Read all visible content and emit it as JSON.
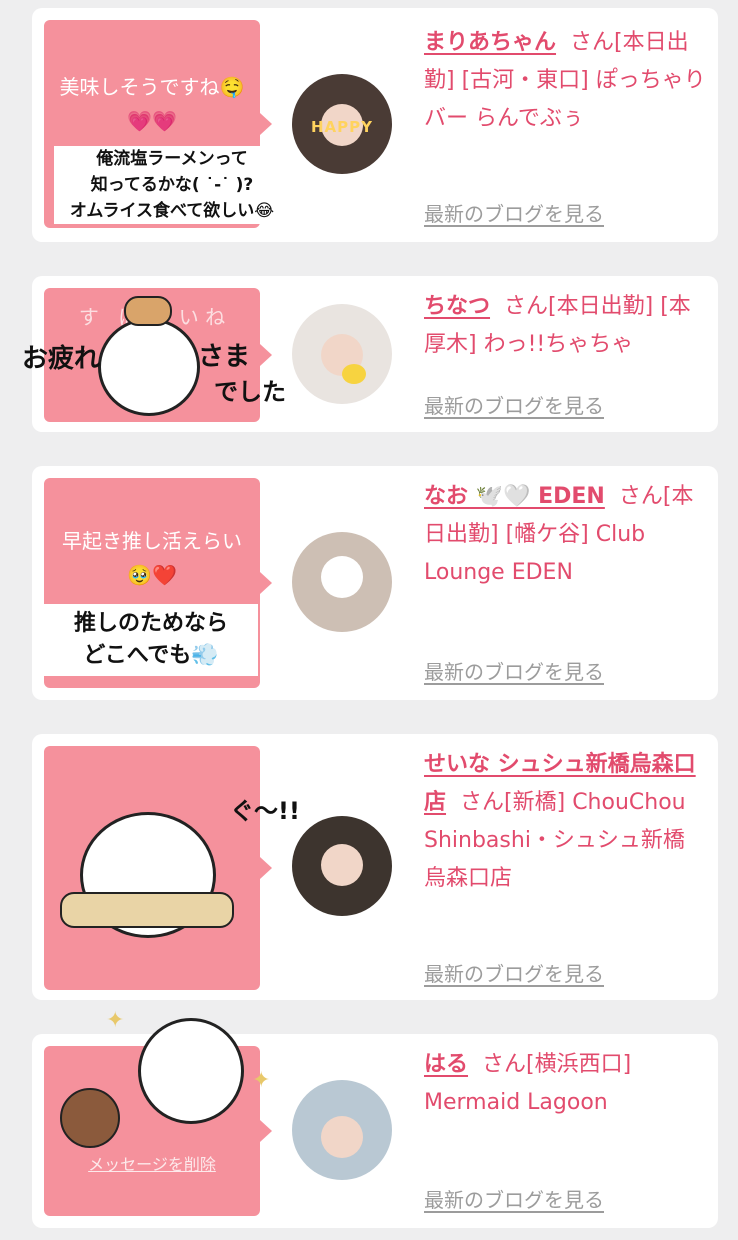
{
  "colors": {
    "accent": "#e24b6d",
    "bubble": "#f5919c",
    "background": "#eeeeef",
    "link_gray": "#9c9c9c"
  },
  "cards": [
    {
      "bubble_text": "美味しそうですね🤤💗💗",
      "caption_lines": [
        "俺流塩ラーメンって",
        "知ってるかな( ˙-˙ )?",
        "オムライス食べて欲しい😂"
      ],
      "avatar_text": "HAPPY",
      "name": "まりあちゃん",
      "san": "さん",
      "details": "[本日出勤] [古河・東口] ぽっちゃりバー らんでぶぅ",
      "blog_link": "最新のブログを見る"
    },
    {
      "bubble_text": "す　ば　　い ね",
      "sticker_text_left": "お疲れ",
      "sticker_text_right_1": "さま",
      "sticker_text_right_2": "でした",
      "name": "ちなつ",
      "san": "さん",
      "details": "[本日出勤] [本厚木] わっ!!ちゃちゃ",
      "blog_link": "最新のブログを見る"
    },
    {
      "bubble_text": "早起き推し活えらい🥹❤️",
      "caption_lines": [
        "推しのためなら",
        "どこへでも💨"
      ],
      "name": "なお 🕊️🤍 EDEN",
      "san": "さん",
      "details": "[本日出勤] [幡ケ谷] Club Lounge EDEN",
      "blog_link": "最新のブログを見る"
    },
    {
      "sticker_text": "ぐ〜!!",
      "name": "せいな シュシュ新橋烏森口店",
      "san": "さん",
      "details": "[新橋] ChouChou Shinbashi・シュシュ新橋烏森口店",
      "blog_link": "最新のブログを見る"
    },
    {
      "bubble_text": "メッセージを削除",
      "name": "はる",
      "san": "さん",
      "details": "[横浜西口] Mermaid Lagoon",
      "blog_link": "最新のブログを見る"
    }
  ]
}
